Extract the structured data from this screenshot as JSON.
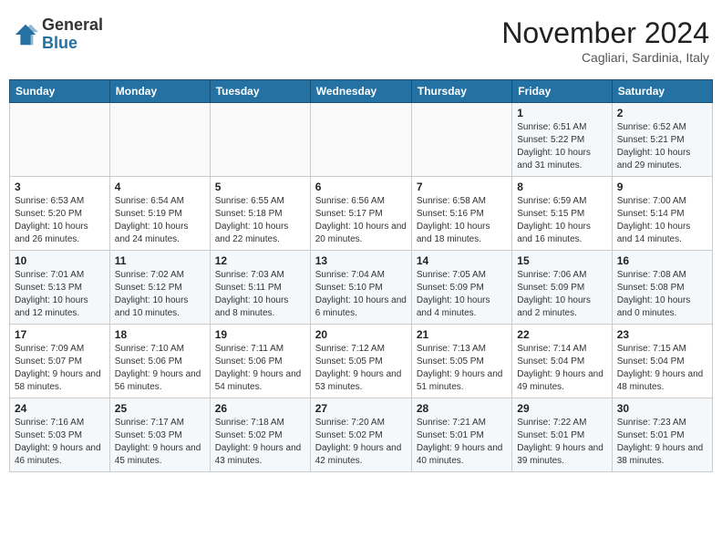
{
  "header": {
    "logo_general": "General",
    "logo_blue": "Blue",
    "month_title": "November 2024",
    "location": "Cagliari, Sardinia, Italy"
  },
  "days_of_week": [
    "Sunday",
    "Monday",
    "Tuesday",
    "Wednesday",
    "Thursday",
    "Friday",
    "Saturday"
  ],
  "weeks": [
    [
      {
        "day": "",
        "info": ""
      },
      {
        "day": "",
        "info": ""
      },
      {
        "day": "",
        "info": ""
      },
      {
        "day": "",
        "info": ""
      },
      {
        "day": "",
        "info": ""
      },
      {
        "day": "1",
        "info": "Sunrise: 6:51 AM\nSunset: 5:22 PM\nDaylight: 10 hours and 31 minutes."
      },
      {
        "day": "2",
        "info": "Sunrise: 6:52 AM\nSunset: 5:21 PM\nDaylight: 10 hours and 29 minutes."
      }
    ],
    [
      {
        "day": "3",
        "info": "Sunrise: 6:53 AM\nSunset: 5:20 PM\nDaylight: 10 hours and 26 minutes."
      },
      {
        "day": "4",
        "info": "Sunrise: 6:54 AM\nSunset: 5:19 PM\nDaylight: 10 hours and 24 minutes."
      },
      {
        "day": "5",
        "info": "Sunrise: 6:55 AM\nSunset: 5:18 PM\nDaylight: 10 hours and 22 minutes."
      },
      {
        "day": "6",
        "info": "Sunrise: 6:56 AM\nSunset: 5:17 PM\nDaylight: 10 hours and 20 minutes."
      },
      {
        "day": "7",
        "info": "Sunrise: 6:58 AM\nSunset: 5:16 PM\nDaylight: 10 hours and 18 minutes."
      },
      {
        "day": "8",
        "info": "Sunrise: 6:59 AM\nSunset: 5:15 PM\nDaylight: 10 hours and 16 minutes."
      },
      {
        "day": "9",
        "info": "Sunrise: 7:00 AM\nSunset: 5:14 PM\nDaylight: 10 hours and 14 minutes."
      }
    ],
    [
      {
        "day": "10",
        "info": "Sunrise: 7:01 AM\nSunset: 5:13 PM\nDaylight: 10 hours and 12 minutes."
      },
      {
        "day": "11",
        "info": "Sunrise: 7:02 AM\nSunset: 5:12 PM\nDaylight: 10 hours and 10 minutes."
      },
      {
        "day": "12",
        "info": "Sunrise: 7:03 AM\nSunset: 5:11 PM\nDaylight: 10 hours and 8 minutes."
      },
      {
        "day": "13",
        "info": "Sunrise: 7:04 AM\nSunset: 5:10 PM\nDaylight: 10 hours and 6 minutes."
      },
      {
        "day": "14",
        "info": "Sunrise: 7:05 AM\nSunset: 5:09 PM\nDaylight: 10 hours and 4 minutes."
      },
      {
        "day": "15",
        "info": "Sunrise: 7:06 AM\nSunset: 5:09 PM\nDaylight: 10 hours and 2 minutes."
      },
      {
        "day": "16",
        "info": "Sunrise: 7:08 AM\nSunset: 5:08 PM\nDaylight: 10 hours and 0 minutes."
      }
    ],
    [
      {
        "day": "17",
        "info": "Sunrise: 7:09 AM\nSunset: 5:07 PM\nDaylight: 9 hours and 58 minutes."
      },
      {
        "day": "18",
        "info": "Sunrise: 7:10 AM\nSunset: 5:06 PM\nDaylight: 9 hours and 56 minutes."
      },
      {
        "day": "19",
        "info": "Sunrise: 7:11 AM\nSunset: 5:06 PM\nDaylight: 9 hours and 54 minutes."
      },
      {
        "day": "20",
        "info": "Sunrise: 7:12 AM\nSunset: 5:05 PM\nDaylight: 9 hours and 53 minutes."
      },
      {
        "day": "21",
        "info": "Sunrise: 7:13 AM\nSunset: 5:05 PM\nDaylight: 9 hours and 51 minutes."
      },
      {
        "day": "22",
        "info": "Sunrise: 7:14 AM\nSunset: 5:04 PM\nDaylight: 9 hours and 49 minutes."
      },
      {
        "day": "23",
        "info": "Sunrise: 7:15 AM\nSunset: 5:04 PM\nDaylight: 9 hours and 48 minutes."
      }
    ],
    [
      {
        "day": "24",
        "info": "Sunrise: 7:16 AM\nSunset: 5:03 PM\nDaylight: 9 hours and 46 minutes."
      },
      {
        "day": "25",
        "info": "Sunrise: 7:17 AM\nSunset: 5:03 PM\nDaylight: 9 hours and 45 minutes."
      },
      {
        "day": "26",
        "info": "Sunrise: 7:18 AM\nSunset: 5:02 PM\nDaylight: 9 hours and 43 minutes."
      },
      {
        "day": "27",
        "info": "Sunrise: 7:20 AM\nSunset: 5:02 PM\nDaylight: 9 hours and 42 minutes."
      },
      {
        "day": "28",
        "info": "Sunrise: 7:21 AM\nSunset: 5:01 PM\nDaylight: 9 hours and 40 minutes."
      },
      {
        "day": "29",
        "info": "Sunrise: 7:22 AM\nSunset: 5:01 PM\nDaylight: 9 hours and 39 minutes."
      },
      {
        "day": "30",
        "info": "Sunrise: 7:23 AM\nSunset: 5:01 PM\nDaylight: 9 hours and 38 minutes."
      }
    ]
  ]
}
